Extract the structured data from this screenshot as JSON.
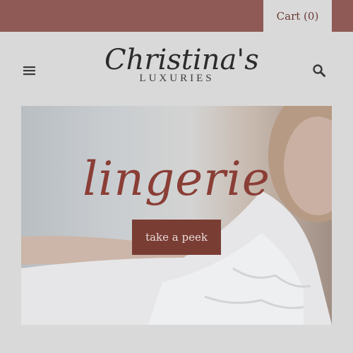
{
  "header": {
    "cart_label": "Cart (0)",
    "logo_script": "Christina's",
    "logo_subtitle": "LUXURIES"
  },
  "icons": {
    "menu": "hamburger-menu-icon",
    "search": "search-icon"
  },
  "hero": {
    "title": "lingerie",
    "cta_label": "take a peek"
  },
  "colors": {
    "top_bar": "#8f5a56",
    "page_background": "#d9d9d9",
    "accent": "#7a3d34",
    "hero_title": "#8a3e36"
  }
}
